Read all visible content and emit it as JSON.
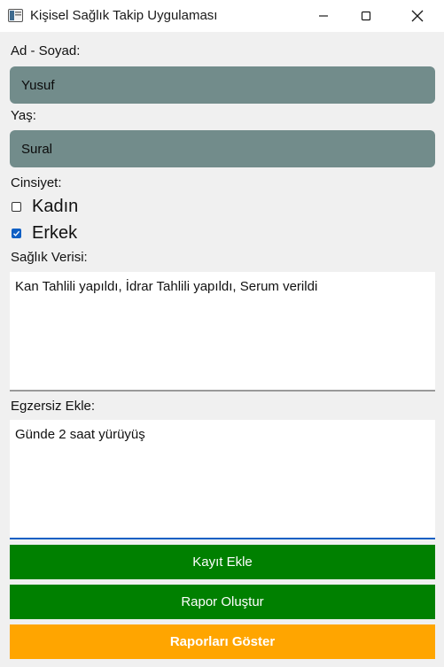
{
  "window": {
    "title": "Kişisel Sağlık Takip Uygulaması",
    "controls": [
      "minimize-icon",
      "maximize-icon",
      "close-icon"
    ]
  },
  "form": {
    "name_label": "Ad - Soyad:",
    "name_value": "Yusuf",
    "age_label": "Yaş:",
    "age_value": "Sural",
    "gender_label": "Cinsiyet:",
    "gender_options": [
      {
        "label": "Kadın",
        "checked": false
      },
      {
        "label": "Erkek",
        "checked": true
      }
    ],
    "health_label": "Sağlık Verisi:",
    "health_value": "Kan Tahlili yapıldı, İdrar Tahlili yapıldı, Serum verildi",
    "exercise_label": "Egzersiz Ekle:",
    "exercise_value": "Günde 2 saat yürüyüş"
  },
  "buttons": {
    "add_record": "Kayıt Ekle",
    "create_report": "Rapor Oluştur",
    "show_reports": "Raporları Göster"
  },
  "colors": {
    "field_bg": "#728c8b",
    "green_button": "#008000",
    "orange_button": "#ffa500",
    "focus_accent": "#0f5fc4"
  }
}
